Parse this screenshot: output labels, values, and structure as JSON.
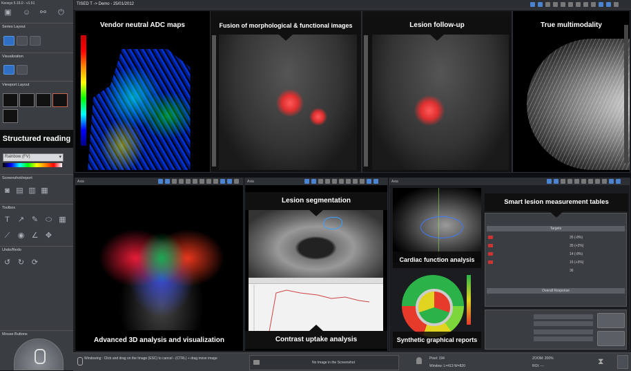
{
  "app": {
    "title": "Keosys 5.16.0 - v1.51",
    "viewer_title": "TISED T -> Demo - 25/01/2012"
  },
  "sidebar": {
    "series_layout_label": "Series Layout",
    "visualization_label": "Visualization",
    "viewport_layout_label": "Viewport Layout",
    "colormap_value": "Rainbow (FV)",
    "screenshot_label": "Screenshot/report",
    "toolbox_label": "Toolbox",
    "undo_redo_label": "Undo/Redo",
    "mouse_buttons_label": "Mouse Buttons"
  },
  "banners": {
    "structured_reading": "Structured reading",
    "vendor_neutral": "Vendor neutral ADC maps",
    "fusion": "Fusion of morphological & functional images",
    "lesion_followup": "Lesion follow-up",
    "true_multimodality": "True multimodality",
    "advanced_3d": "Advanced 3D analysis and visualization",
    "lesion_segmentation": "Lesion segmentation",
    "contrast_uptake": "Contrast uptake analysis",
    "smart_lesion": "Smart lesion measurement tables",
    "cardiac_function": "Cardiac function analysis",
    "synthetic_reports": "Synthetic graphical reports"
  },
  "panels": {
    "axial_a": "Axia",
    "axial_b": "Axia",
    "axial_c": "Axia"
  },
  "table": {
    "header": "Targets",
    "rows": [
      "35 (-8%)",
      "35 (+2%)",
      "14 (-8%)",
      "15 (+3%)",
      "36"
    ],
    "overall": "Overall Response"
  },
  "status": {
    "hint": "Windowing : Click and drag on the Image (ESC) to cancel - (CTRL) + drag move image",
    "screenshot": "No Image in the Screenshot",
    "pixel": "Pixel: 194",
    "window": "Window: L=413 W=820",
    "zoom": "ZOOM: 200%",
    "roi": "ROI: ---"
  },
  "colors": {
    "accent": "#2f6fc4",
    "panel_bg": "#000000",
    "sidebar_bg": "#3a3d42"
  }
}
